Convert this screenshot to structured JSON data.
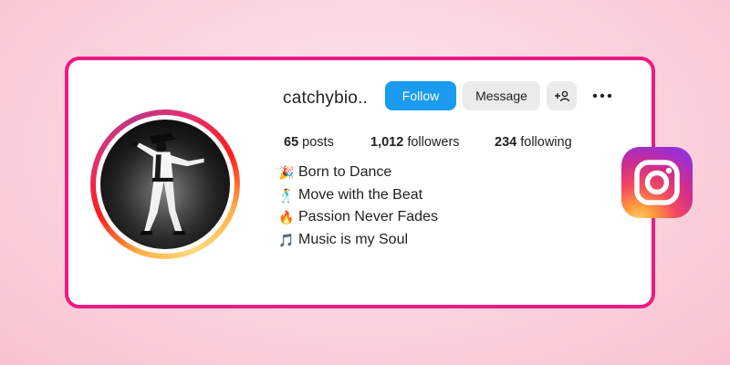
{
  "profile": {
    "username": "catchybio..",
    "follow_label": "Follow",
    "message_label": "Message"
  },
  "stats": {
    "posts_count": "65",
    "posts_label": "posts",
    "followers_count": "1,012",
    "followers_label": "followers",
    "following_count": "234",
    "following_label": "following"
  },
  "bio": [
    {
      "icon": "party-popper-icon",
      "emoji": "🎉",
      "text": "Born to Dance"
    },
    {
      "icon": "dancer-icon",
      "emoji": "🕺",
      "text": "Move with the Beat"
    },
    {
      "icon": "fire-icon",
      "emoji": "🔥",
      "text": "Passion Never Fades"
    },
    {
      "icon": "music-notes-icon",
      "emoji": "🎵",
      "text": "Music is my Soul"
    }
  ],
  "colors": {
    "accent_border": "#ec1a84",
    "follow_button": "#1a9bf0",
    "secondary_button": "#ebebeb"
  }
}
